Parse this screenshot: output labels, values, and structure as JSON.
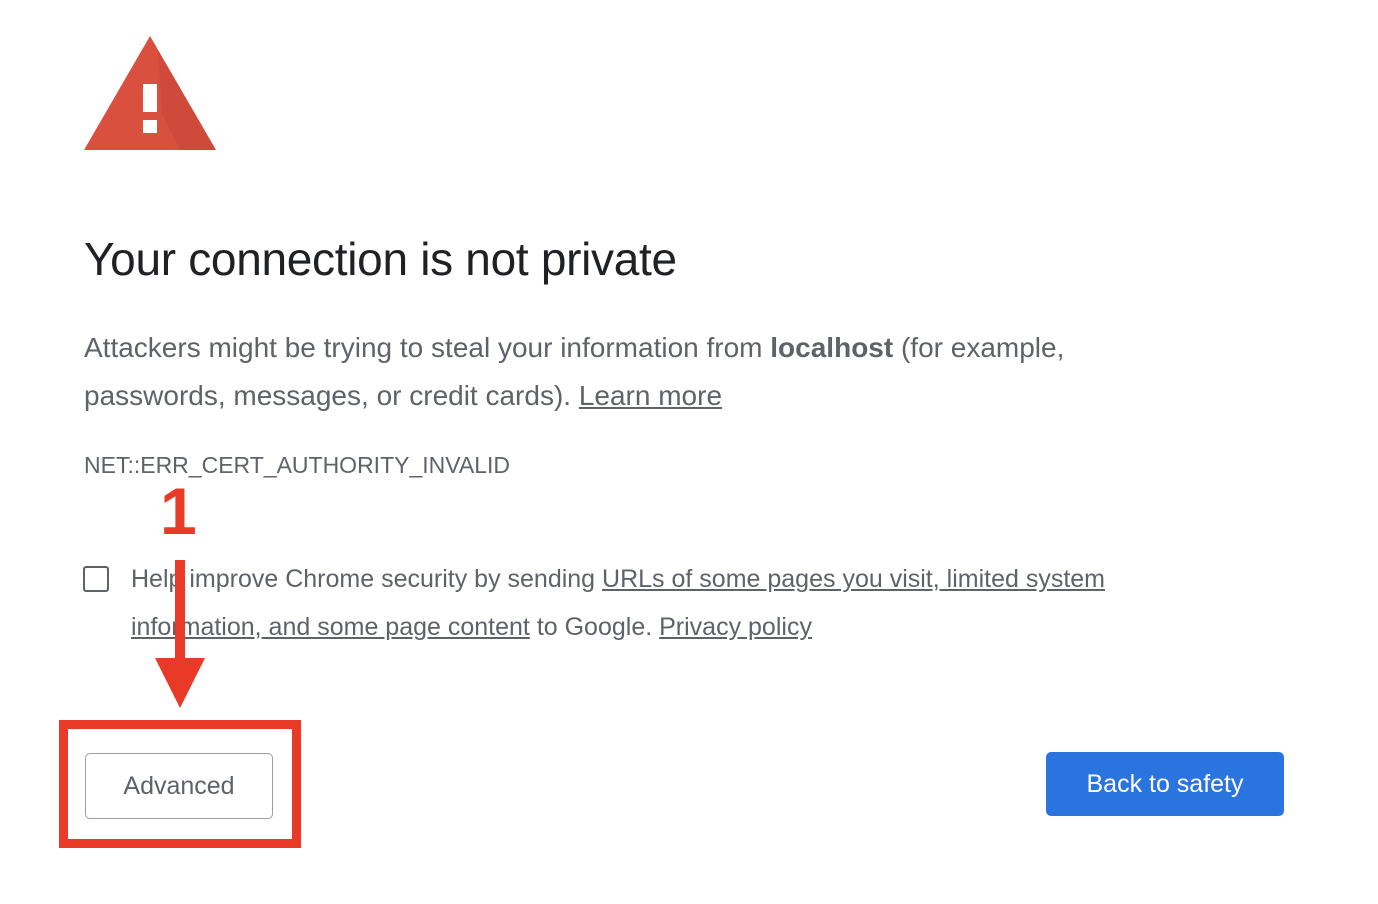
{
  "interstitial": {
    "title": "Your connection is not private",
    "description_before": "Attackers might be trying to steal your information from ",
    "host": "localhost",
    "description_after": " (for example, passwords, messages, or credit cards). ",
    "learn_more": "Learn more",
    "error_code": "NET::ERR_CERT_AUTHORITY_INVALID",
    "optin_before": "Help improve Chrome security by sending ",
    "optin_link": "URLs of some pages you visit, limited system information, and some page content",
    "optin_middle": " to Google. ",
    "privacy_policy": "Privacy policy",
    "advanced_label": "Advanced",
    "back_label": "Back to safety",
    "checkbox_checked": false
  },
  "annotation": {
    "step_number": "1",
    "color": "#e83a26"
  },
  "colors": {
    "warning_red": "#d9503f",
    "primary_blue": "#2a74e0",
    "text_gray": "#5f6368"
  }
}
